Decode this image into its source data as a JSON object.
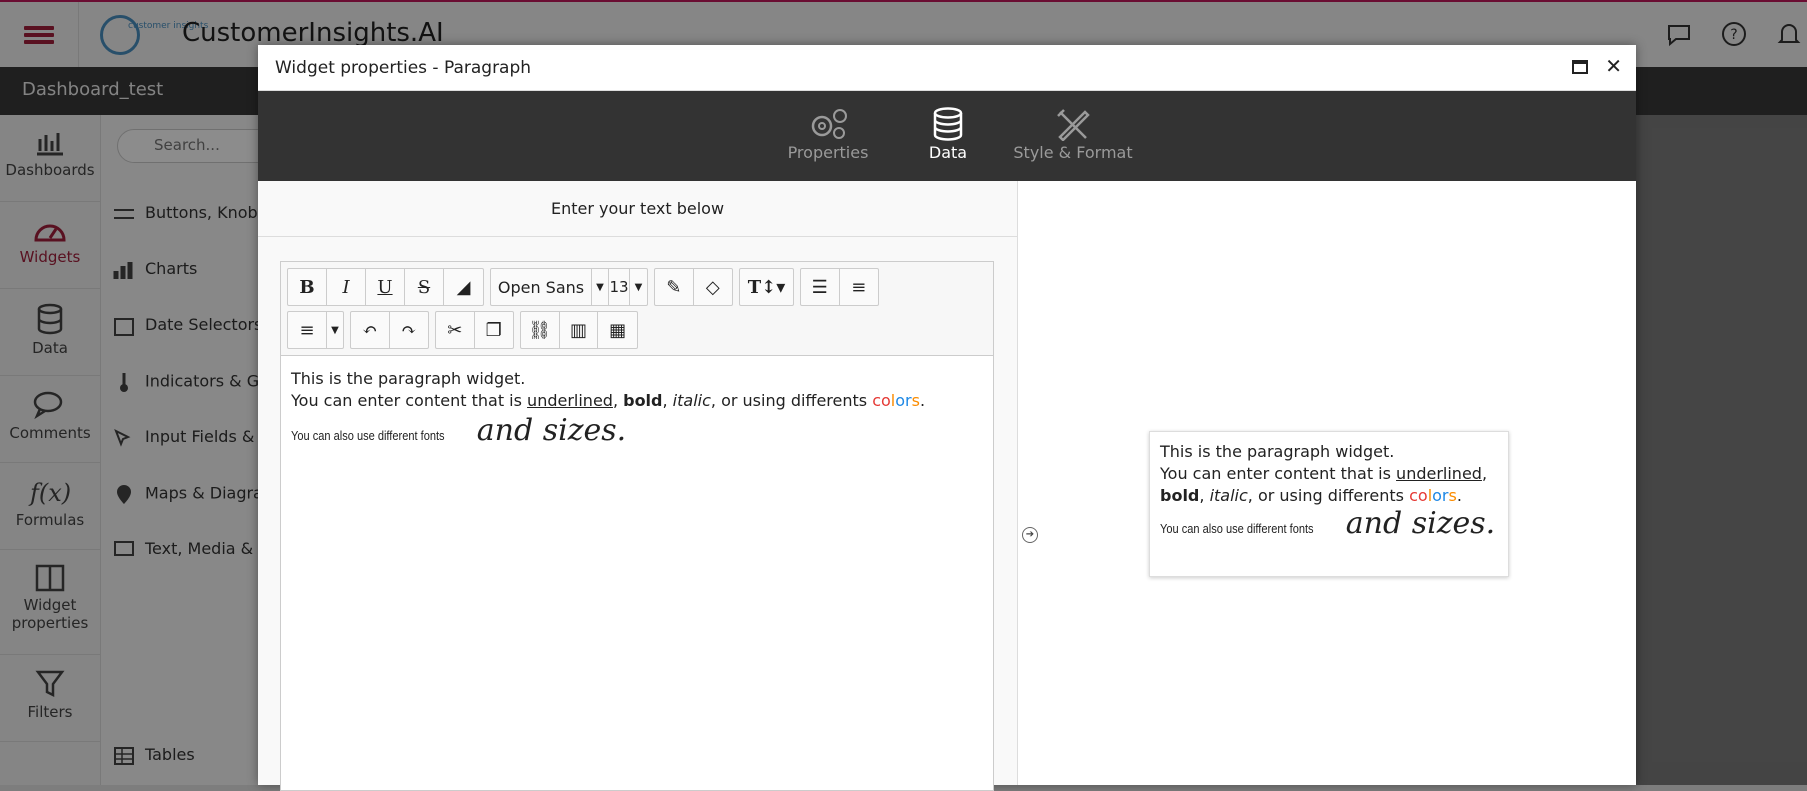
{
  "app": {
    "title": "CustomerInsights.AI",
    "logo_text": "customer insights"
  },
  "dashboard": {
    "title": "Dashboard_test"
  },
  "left_nav": [
    {
      "label": "Dashboards",
      "icon": "bar-chart-icon"
    },
    {
      "label": "Widgets",
      "icon": "speedometer-icon"
    },
    {
      "label": "Data",
      "icon": "database-icon"
    },
    {
      "label": "Comments",
      "icon": "chat-icon"
    },
    {
      "label": "Formulas",
      "icon": "function-icon"
    },
    {
      "label": "Widget properties",
      "icon": "layout-icon"
    },
    {
      "label": "Filters",
      "icon": "filter-icon"
    }
  ],
  "panel": {
    "search_placeholder": "Search...",
    "items": [
      {
        "label": "Buttons, Knobs"
      },
      {
        "label": "Charts"
      },
      {
        "label": "Date Selectors"
      },
      {
        "label": "Indicators & Ga"
      },
      {
        "label": "Input Fields & L"
      },
      {
        "label": "Maps & Diagram"
      },
      {
        "label": "Text, Media & S"
      },
      {
        "label": "Tables"
      }
    ]
  },
  "dialog": {
    "title": "Widget properties - Paragraph",
    "tabs": [
      {
        "label": "Properties",
        "icon": "gears-icon"
      },
      {
        "label": "Data",
        "icon": "database-icon"
      },
      {
        "label": "Style & Format",
        "icon": "pencil-ruler-icon"
      }
    ],
    "active_tab": "Data",
    "editor_header": "Enter your text below",
    "toolbar": {
      "font_name": "Open Sans",
      "font_size": "13"
    },
    "content": {
      "line1": "This is the paragraph widget.",
      "line2_prefix": "You can enter content that is ",
      "underlined": "underlined",
      "sep1": ", ",
      "bold": "bold",
      "sep2": ", ",
      "italic": "italic",
      "line2_suffix": ", or using differents ",
      "colors_parts": [
        "co",
        "l",
        "or",
        "s"
      ],
      "period": ".",
      "small_text": "You can also use different fonts",
      "script_text": "and sizes."
    }
  },
  "colors": {
    "accent": "#a31f3c",
    "brand_blue": "#4a90c2"
  }
}
